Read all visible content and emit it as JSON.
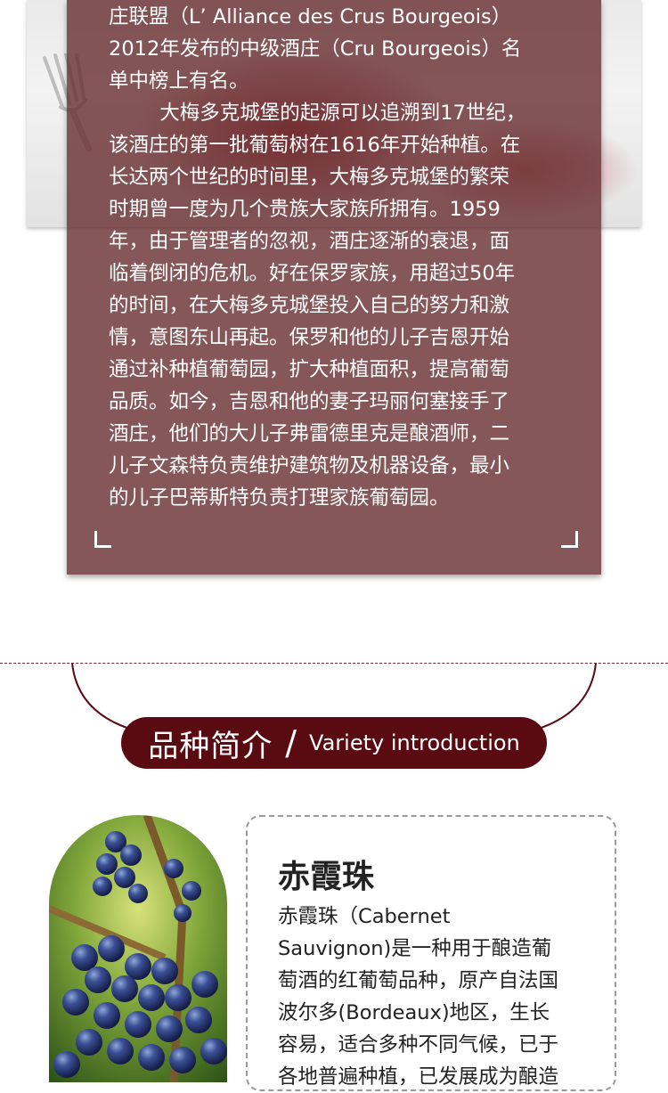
{
  "history": {
    "paragraph1": "庄联盟（L’ Alliance des Crus Bourgeois）\n2012年发布的中级酒庄（Cru Bourgeois）名\n单中榜上有名。",
    "paragraph2": "        大梅多克城堡的起源可以追溯到17世纪，\n该酒庄的第一批葡萄树在1616年开始种植。在\n长达两个世纪的时间里，大梅多克城堡的繁荣\n时期曾一度为几个贵族大家族所拥有。1959\n年，由于管理者的忽视，酒庄逐渐的衰退，面\n临着倒闭的危机。好在保罗家族，用超过50年\n的时间，在大梅多克城堡投入自己的努力和激\n情，意图东山再起。保罗和他的儿子吉恩开始\n通过补种植葡萄园，扩大种植面积，提高葡萄\n品质。如今，吉恩和他的妻子玛丽何塞接手了\n酒庄，他们的大儿子弗雷德里克是酿酒师，二\n儿子文森特负责维护建筑物及机器设备，最小\n的儿子巴蒂斯特负责打理家族葡萄园。"
  },
  "section": {
    "title_cn": "品种简介",
    "separator": "/",
    "title_en": "Variety introduction"
  },
  "variety": {
    "name": "赤霞珠",
    "description": "赤霞珠（Cabernet\nSauvignon)是一种用于酿造葡\n萄酒的红葡萄品种，原产自法国\n波尔多(Bordeaux)地区，生长\n容易，适合多种不同气候，已于\n各地普遍种植，已发展成为酿造"
  },
  "colors": {
    "text_box": "#682d30",
    "banner": "#5a0b11",
    "accent_line": "#6a2a2d"
  }
}
